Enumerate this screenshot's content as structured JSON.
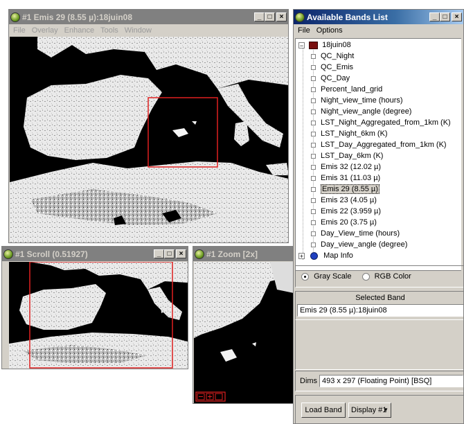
{
  "image_window": {
    "title": "#1 Emis 29 (8.55 µ):18juin08",
    "menu": [
      "File",
      "Overlay",
      "Enhance",
      "Tools",
      "Window"
    ]
  },
  "scroll_window": {
    "title": "#1 Scroll (0.51927)"
  },
  "zoom_window": {
    "title": "#1 Zoom [2x]"
  },
  "bands_window": {
    "title": "Available Bands List",
    "menu": [
      "File",
      "Options"
    ],
    "tree_root": "18juin08",
    "bands": [
      "QC_Night",
      "QC_Emis",
      "QC_Day",
      "Percent_land_grid",
      "Night_view_time (hours)",
      "Night_view_angle (degree)",
      "LST_Night_Aggregated_from_1km (K)",
      "LST_Night_6km (K)",
      "LST_Day_Aggregated_from_1km (K)",
      "LST_Day_6km (K)",
      "Emis 32 (12.02 µ)",
      "Emis 31 (11.03 µ)",
      "Emis 29 (8.55 µ)",
      "Emis 23 (4.05 µ)",
      "Emis 22 (3.959 µ)",
      "Emis 20 (3.75 µ)",
      "Day_View_time (hours)",
      "Day_view_angle (degree)"
    ],
    "selected_index": 12,
    "map_info": "Map Info",
    "mode_gray": "Gray Scale",
    "mode_rgb": "RGB Color",
    "selected_mode": "Gray Scale",
    "selected_band_label": "Selected Band",
    "selected_band_value": "Emis 29 (8.55 µ):18juin08",
    "dims_label": "Dims",
    "dims_value": "493 x 297 (Floating Point) [BSQ]",
    "load_band": "Load Band",
    "display_select": "Display #1"
  },
  "window_controls": {
    "minimize": "_",
    "maximize": "□",
    "close": "×"
  },
  "colors": {
    "active_title": "#0a246a",
    "inactive_title": "#808080",
    "roi_box": "#e02020",
    "window_face": "#d4d0c8"
  },
  "icons": [
    "app-globe-icon",
    "minimize-icon",
    "maximize-icon",
    "close-icon",
    "expand-icon",
    "collapse-icon",
    "dataset-icon",
    "globe-icon",
    "dropdown-arrow-icon"
  ]
}
